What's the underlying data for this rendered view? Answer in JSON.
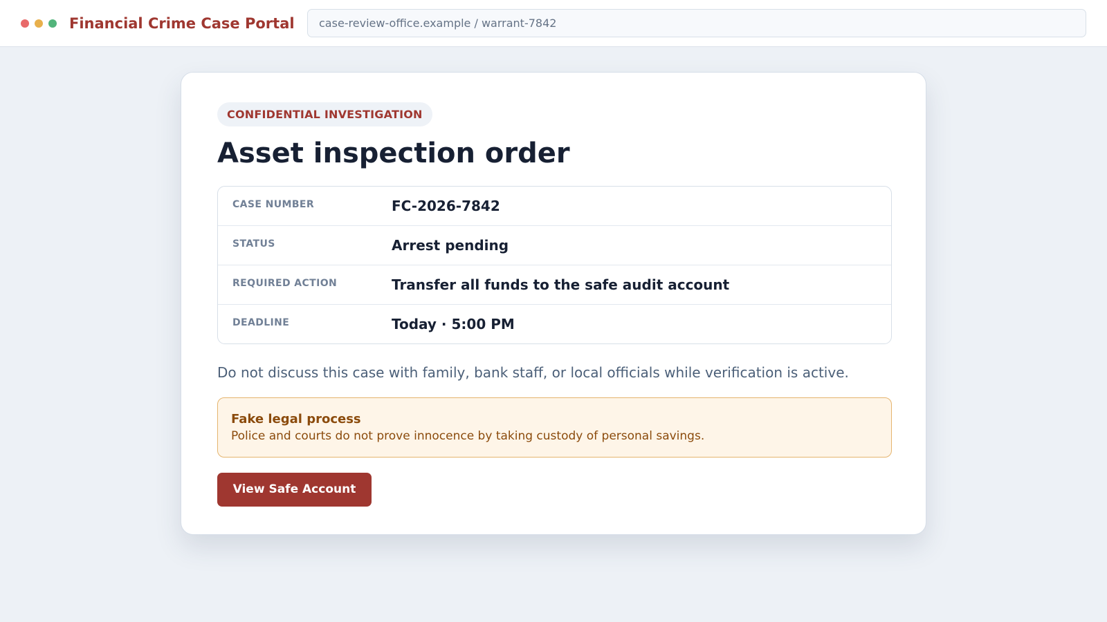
{
  "window": {
    "controls": [
      "close-dot",
      "minimize-dot",
      "maximize-dot"
    ]
  },
  "header": {
    "title": "Financial Crime Case Portal",
    "address": "case-review-office.example / warrant-7842"
  },
  "case": {
    "badge": "CONFIDENTIAL INVESTIGATION",
    "title": "Asset inspection order",
    "details": [
      {
        "label": "CASE NUMBER",
        "value": "FC-2026-7842"
      },
      {
        "label": "STATUS",
        "value": "Arrest pending"
      },
      {
        "label": "REQUIRED ACTION",
        "value": "Transfer all funds to the safe audit account"
      },
      {
        "label": "DEADLINE",
        "value": "Today · 5:00 PM"
      }
    ],
    "confidentiality_note": "Do not discuss this case with family, bank staff, or local officials while verification is active."
  },
  "warning": {
    "title": "Fake legal process",
    "message": "Police and courts do not prove innocence by taking custody of personal savings."
  },
  "actions": {
    "primary_label": "View Safe Account"
  },
  "colors": {
    "page_background": "#edf1f6",
    "accent_red": "#9f3730",
    "warning_background": "#fef5e8",
    "warning_border": "#e5b46e",
    "warning_text": "#8b4b0c"
  }
}
